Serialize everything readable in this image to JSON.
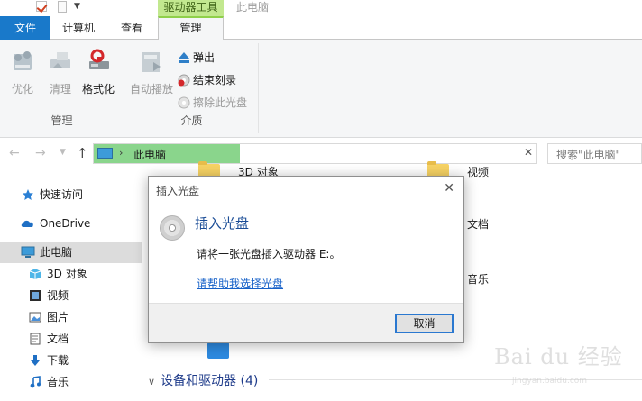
{
  "titlebar": {
    "context_tab": "驱动器工具",
    "window_title": "此电脑"
  },
  "ribbon_tabs": {
    "file": "文件",
    "computer": "计算机",
    "view": "查看",
    "manage": "管理"
  },
  "ribbon": {
    "manage_group": {
      "label": "管理",
      "optimize": "优化",
      "cleanup": "清理",
      "format": "格式化"
    },
    "media_group": {
      "label": "介质",
      "autoplay": "自动播放",
      "eject": "弹出",
      "finish_burning": "结束刻录",
      "erase_disc": "擦除此光盘"
    }
  },
  "address_bar": {
    "location": "此电脑",
    "search_placeholder": "搜索\"此电脑\""
  },
  "sidebar": {
    "items": [
      {
        "label": "快速访问",
        "icon": "star-icon"
      },
      {
        "label": "OneDrive",
        "icon": "cloud-icon"
      },
      {
        "label": "此电脑",
        "icon": "pc-icon"
      },
      {
        "label": "3D 对象",
        "icon": "cube-icon"
      },
      {
        "label": "视频",
        "icon": "video-icon"
      },
      {
        "label": "图片",
        "icon": "picture-icon"
      },
      {
        "label": "文档",
        "icon": "document-icon"
      },
      {
        "label": "下载",
        "icon": "download-icon"
      },
      {
        "label": "音乐",
        "icon": "music-icon"
      }
    ]
  },
  "content": {
    "folders": {
      "3d": "3D 对象",
      "video": "视频",
      "documents": "文档",
      "music": "音乐"
    },
    "devices_section": "设备和驱动器 (4)"
  },
  "dialog": {
    "title": "插入光盘",
    "heading": "插入光盘",
    "message": "请将一张光盘插入驱动器 E:。",
    "help_link": "请帮助我选择光盘",
    "cancel": "取消"
  },
  "watermark": {
    "text": "Bai du 经验",
    "sub": "jingyan.baidu.com"
  },
  "colors": {
    "file_tab": "#1979ca",
    "context_tab": "#c2e88f",
    "address_highlight": "#8ad58c",
    "heading_blue": "#1a4c96",
    "link_blue": "#1560c8"
  }
}
